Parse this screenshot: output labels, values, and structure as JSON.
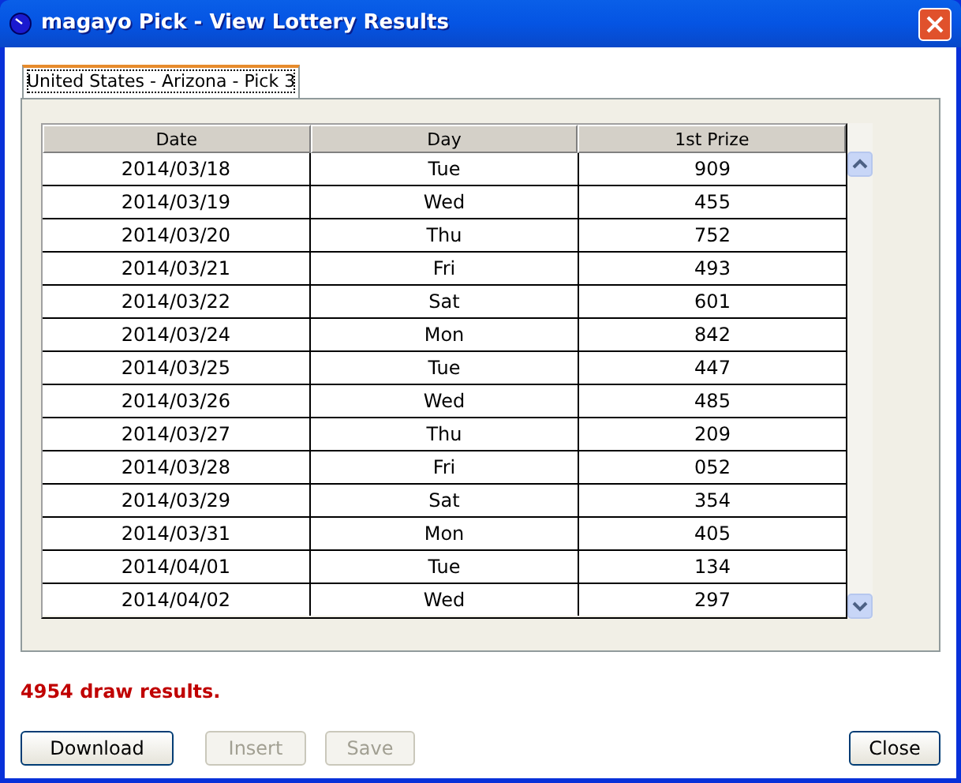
{
  "window": {
    "title": "magayo Pick - View Lottery Results"
  },
  "tabs": [
    {
      "label": "United States - Arizona - Pick 3",
      "selected": true
    }
  ],
  "table": {
    "columns": [
      "Date",
      "Day",
      "1st Prize"
    ],
    "rows": [
      [
        "2014/03/18",
        "Tue",
        "909"
      ],
      [
        "2014/03/19",
        "Wed",
        "455"
      ],
      [
        "2014/03/20",
        "Thu",
        "752"
      ],
      [
        "2014/03/21",
        "Fri",
        "493"
      ],
      [
        "2014/03/22",
        "Sat",
        "601"
      ],
      [
        "2014/03/24",
        "Mon",
        "842"
      ],
      [
        "2014/03/25",
        "Tue",
        "447"
      ],
      [
        "2014/03/26",
        "Wed",
        "485"
      ],
      [
        "2014/03/27",
        "Thu",
        "209"
      ],
      [
        "2014/03/28",
        "Fri",
        "052"
      ],
      [
        "2014/03/29",
        "Sat",
        "354"
      ],
      [
        "2014/03/31",
        "Mon",
        "405"
      ],
      [
        "2014/04/01",
        "Tue",
        "134"
      ],
      [
        "2014/04/02",
        "Wed",
        "297"
      ]
    ]
  },
  "status": "4954 draw results.",
  "buttons": [
    {
      "label": "Download",
      "disabled": false
    },
    {
      "label": "Insert",
      "disabled": true
    },
    {
      "label": "Save",
      "disabled": true
    },
    {
      "label": "Close",
      "disabled": false
    }
  ]
}
